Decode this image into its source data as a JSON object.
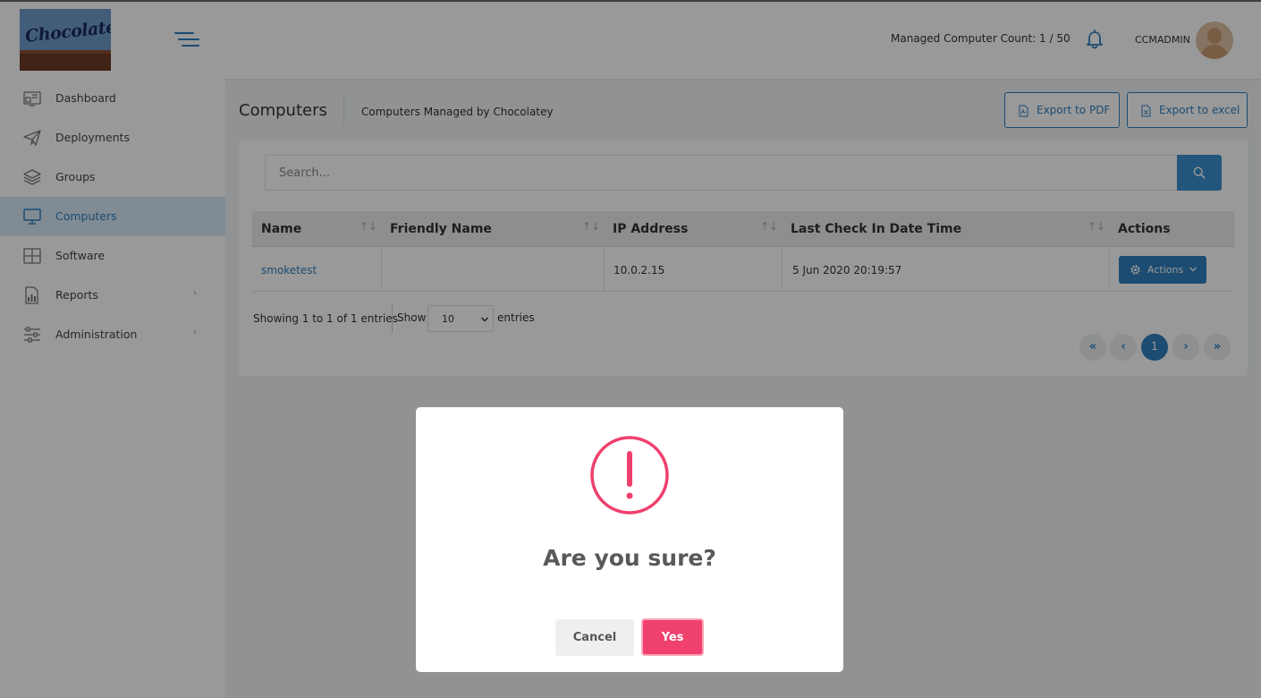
{
  "brand": {
    "logo_text": "Chocolatey"
  },
  "header": {
    "managed_count_label": "Managed Computer Count: 1 / 50",
    "username": "CCMADMIN"
  },
  "sidebar": {
    "items": [
      {
        "label": "Dashboard",
        "icon": "dashboard-icon",
        "active": false
      },
      {
        "label": "Deployments",
        "icon": "paper-plane-icon",
        "active": false
      },
      {
        "label": "Groups",
        "icon": "layers-icon",
        "active": false
      },
      {
        "label": "Computers",
        "icon": "monitor-icon",
        "active": true
      },
      {
        "label": "Software",
        "icon": "grid-icon",
        "active": false
      },
      {
        "label": "Reports",
        "icon": "report-icon",
        "active": false,
        "submenu": true
      },
      {
        "label": "Administration",
        "icon": "sliders-icon",
        "active": false,
        "submenu": true
      }
    ],
    "chevron": "›"
  },
  "page": {
    "title": "Computers",
    "subtitle": "Computers Managed by Chocolatey",
    "export_pdf": "Export to PDF",
    "export_excel": "Export to excel"
  },
  "search": {
    "placeholder": "Search..."
  },
  "table": {
    "columns": [
      "Name",
      "Friendly Name",
      "IP Address",
      "Last Check In Date Time",
      "Actions"
    ],
    "sort_glyph": "↑↓",
    "rows": [
      {
        "name": "smoketest",
        "friendly_name": "",
        "ip_address": "10.0.2.15",
        "last_check_in": "5 Jun 2020 20:19:57",
        "actions_label": "Actions"
      }
    ]
  },
  "footer": {
    "showing": "Showing 1 to 1 of 1 entries",
    "show_label": "Show",
    "page_size": "10",
    "entries_label": "entries"
  },
  "pagination": {
    "first": "«",
    "prev": "‹",
    "current": "1",
    "next": "›",
    "last": "»"
  },
  "dialog": {
    "title": "Are you sure?",
    "cancel_label": "Cancel",
    "confirm_label": "Yes",
    "accent_color": "#f0406d"
  },
  "colors": {
    "primary": "#2f7fbf",
    "danger": "#f0406d"
  }
}
